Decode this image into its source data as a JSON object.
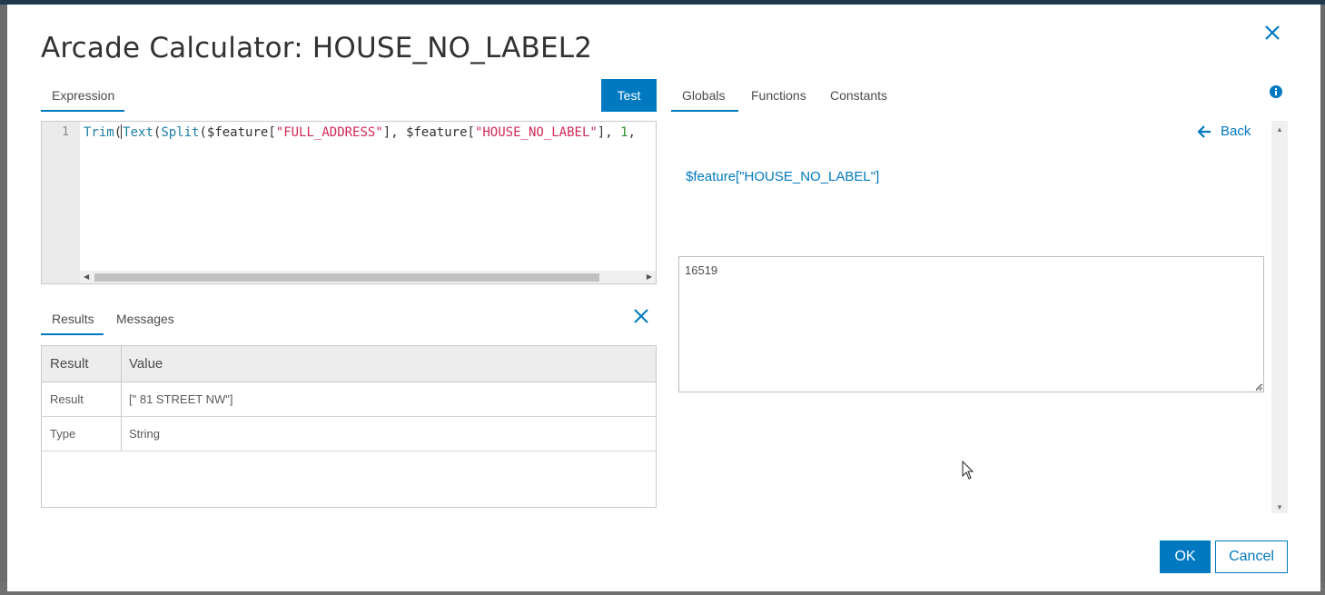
{
  "dialog": {
    "title": "Arcade Calculator: HOUSE_NO_LABEL2",
    "close_icon": "close-icon"
  },
  "expression_tab": {
    "label": "Expression"
  },
  "test_button": {
    "label": "Test"
  },
  "editor": {
    "line_number": "1",
    "tokens": {
      "t1": "Trim",
      "t2": "(",
      "t3": "Text",
      "t4": "(",
      "t5": "Split",
      "t6": "($feature[",
      "t7": "\"FULL_ADDRESS\"",
      "t8": "], $feature[",
      "t9": "\"HOUSE_NO_LABEL\"",
      "t10": "], ",
      "t11": "1",
      "t12": ","
    }
  },
  "results_tabs": [
    {
      "label": "Results",
      "active": true
    },
    {
      "label": "Messages",
      "active": false
    }
  ],
  "results_table": {
    "headers": [
      "Result",
      "Value"
    ],
    "rows": [
      [
        "Result",
        "[\" 81 STREET NW\"]"
      ],
      [
        "Type",
        "String"
      ]
    ]
  },
  "right_tabs": [
    {
      "label": "Globals",
      "active": true
    },
    {
      "label": "Functions",
      "active": false
    },
    {
      "label": "Constants",
      "active": false
    }
  ],
  "right_panel": {
    "back_label": "Back",
    "feature_ref": "$feature[\"HOUSE_NO_LABEL\"]",
    "value": "16519"
  },
  "footer": {
    "ok_label": "OK",
    "cancel_label": "Cancel"
  },
  "colors": {
    "accent": "#0079c1",
    "string_token": "#d12a5a",
    "number_token": "#2d8c2d",
    "function_token": "#1e7da8"
  }
}
